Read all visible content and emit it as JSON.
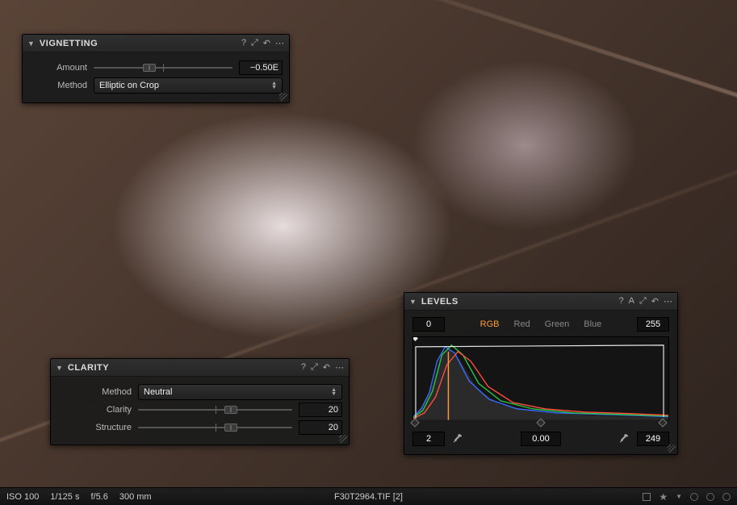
{
  "panels": {
    "vignetting": {
      "title": "VIGNETTING",
      "amount_label": "Amount",
      "amount_value": "−0.50E",
      "amount_pos_pct": 40,
      "method_label": "Method",
      "method_value": "Elliptic on Crop"
    },
    "clarity": {
      "title": "CLARITY",
      "method_label": "Method",
      "method_value": "Neutral",
      "clarity_label": "Clarity",
      "clarity_value": "20",
      "clarity_pos_pct": 60,
      "structure_label": "Structure",
      "structure_value": "20",
      "structure_pos_pct": 60
    },
    "levels": {
      "title": "LEVELS",
      "channels": {
        "rgb": "RGB",
        "red": "Red",
        "green": "Green",
        "blue": "Blue"
      },
      "in_black": "0",
      "in_white": "255",
      "out_black": "2",
      "gamma": "0.00",
      "out_white": "249",
      "black_handle_pct": 1,
      "mid_handle_pct": 50,
      "white_handle_pct": 97.5
    }
  },
  "status": {
    "iso": "ISO 100",
    "shutter": "1/125 s",
    "aperture": "f/5.6",
    "focal": "300 mm",
    "filename": "F30T2964.TIF [2]"
  }
}
